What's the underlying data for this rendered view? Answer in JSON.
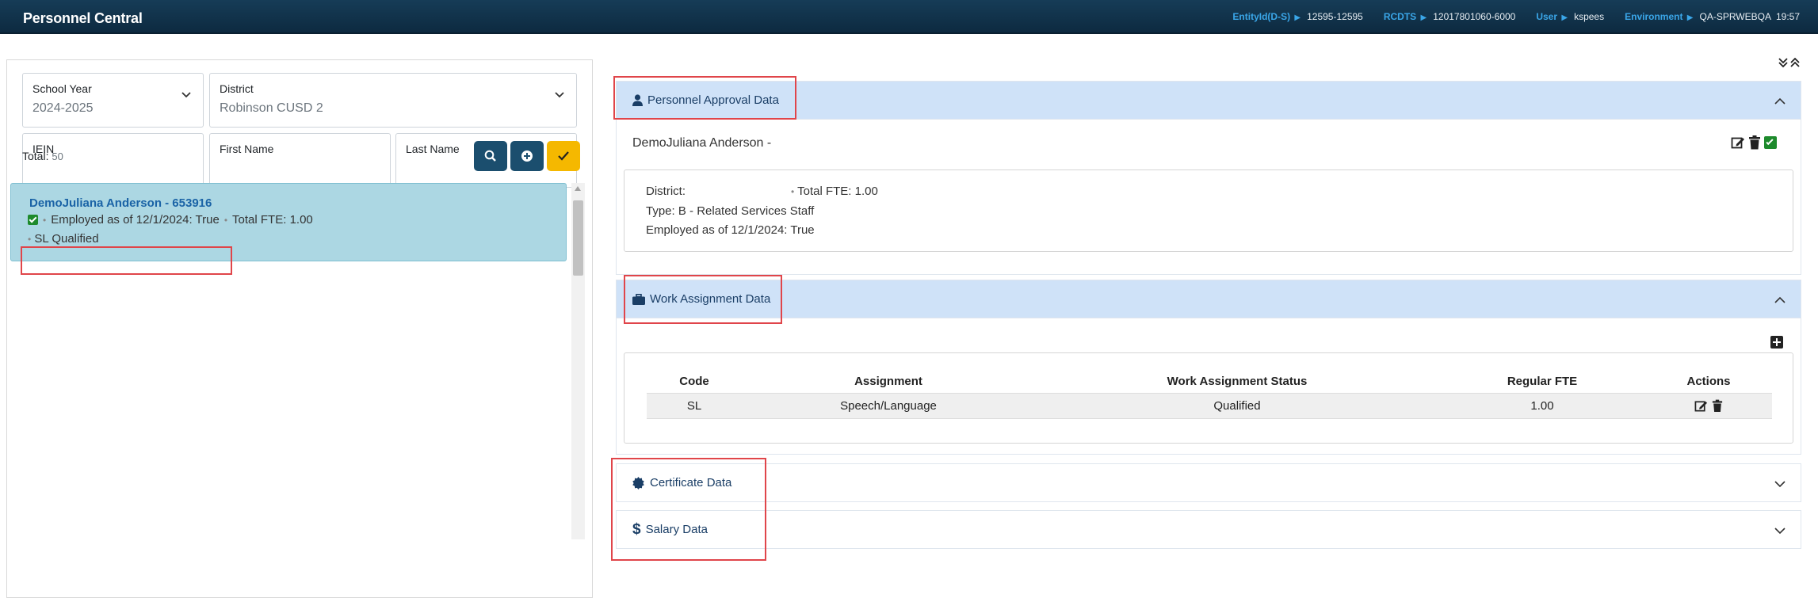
{
  "header": {
    "app_title": "Personnel Central",
    "entity_label": "EntityId(D-S)",
    "entity_value": "12595-12595",
    "rcdts_label": "RCDTS",
    "rcdts_value": "12017801060-6000",
    "user_label": "User",
    "user_value": "kspees",
    "env_label": "Environment",
    "env_value": "QA-SPRWEBQA",
    "time": "19:57"
  },
  "filters": {
    "school_year_label": "School Year",
    "school_year_value": "2024-2025",
    "district_label": "District",
    "district_value": "Robinson CUSD 2",
    "iein_label": "IEIN",
    "first_name_label": "First Name",
    "last_name_label": "Last Name"
  },
  "results": {
    "total_label": "Total:",
    "total_count": "50",
    "items": [
      {
        "name": "DemoJuliana Anderson - 653916",
        "line1_employed": "Employed as of 12/1/2024: True",
        "line1_fte": "Total FTE: 1.00",
        "line2": "SL Qualified"
      }
    ]
  },
  "sections": {
    "approval": {
      "title": "Personnel Approval Data",
      "person": "DemoJuliana Anderson -",
      "district": "District:",
      "total_fte": "Total FTE: 1.00",
      "type": "Type: B - Related Services Staff",
      "employed": "Employed as of 12/1/2024: True"
    },
    "work_assignment": {
      "title": "Work Assignment Data",
      "columns": [
        "Code",
        "Assignment",
        "Work Assignment Status",
        "Regular FTE",
        "Actions"
      ],
      "rows": [
        {
          "code": "SL",
          "assignment": "Speech/Language",
          "status": "Qualified",
          "fte": "1.00"
        }
      ]
    },
    "certificate": {
      "title": "Certificate Data"
    },
    "salary": {
      "title": "Salary Data"
    }
  },
  "colors": {
    "topbar": "#0f3048",
    "accent_blue": "#3aa6e8",
    "section_open_bg": "#cfe2f8",
    "result_selected_bg": "#acd7e3",
    "search_btn": "#1b4e6e",
    "approve_btn": "#f5b800",
    "highlight_red": "#e0454a"
  }
}
